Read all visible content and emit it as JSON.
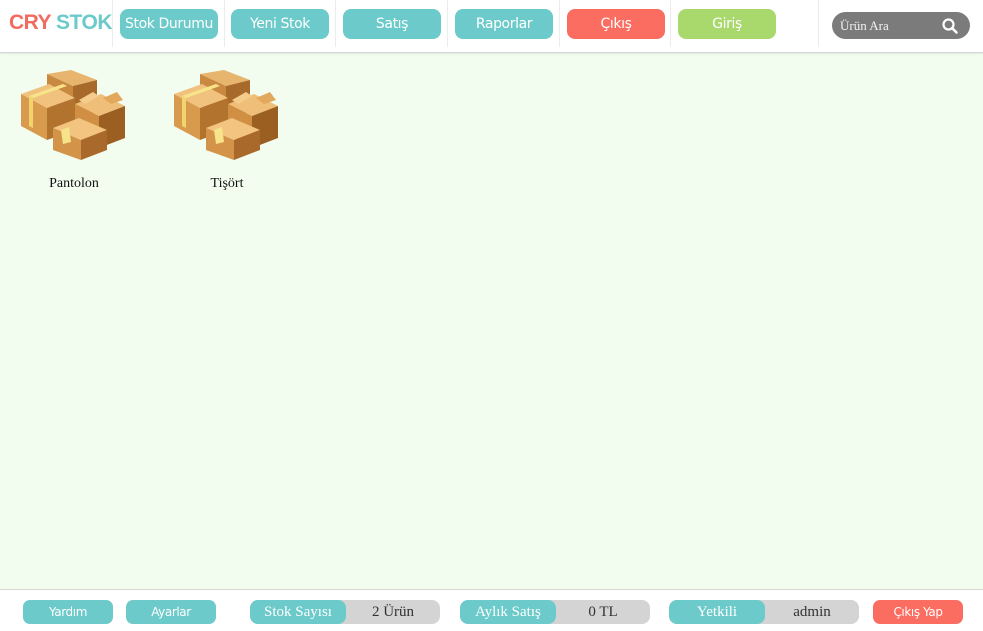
{
  "logo": {
    "part1": "CRY",
    "part2": "STOK"
  },
  "nav": {
    "stock_status": "Stok Durumu",
    "new_stock": "Yeni Stok",
    "sales": "Satış",
    "reports": "Raporlar",
    "exit": "Çıkış",
    "entry": "Giriş"
  },
  "search": {
    "placeholder": "Ürün Ara",
    "icon": "search-icon"
  },
  "items": [
    {
      "label": "Pantolon",
      "icon": "cardboard-boxes-icon"
    },
    {
      "label": "Tişört",
      "icon": "cardboard-boxes-icon"
    }
  ],
  "footer": {
    "help": "Yardım",
    "settings": "Ayarlar",
    "stock_count_label": "Stok Sayısı",
    "stock_count_value": "2 Ürün",
    "monthly_sales_label": "Aylık Satış",
    "monthly_sales_value": "0 TL",
    "authorized_label": "Yetkili",
    "authorized_value": "admin",
    "logout": "Çıkış Yap"
  },
  "colors": {
    "teal": "#6ccaca",
    "red": "#fb6c61",
    "green": "#a9d86d",
    "background": "#f2fdf0",
    "search_bg": "#7b7b7b"
  }
}
